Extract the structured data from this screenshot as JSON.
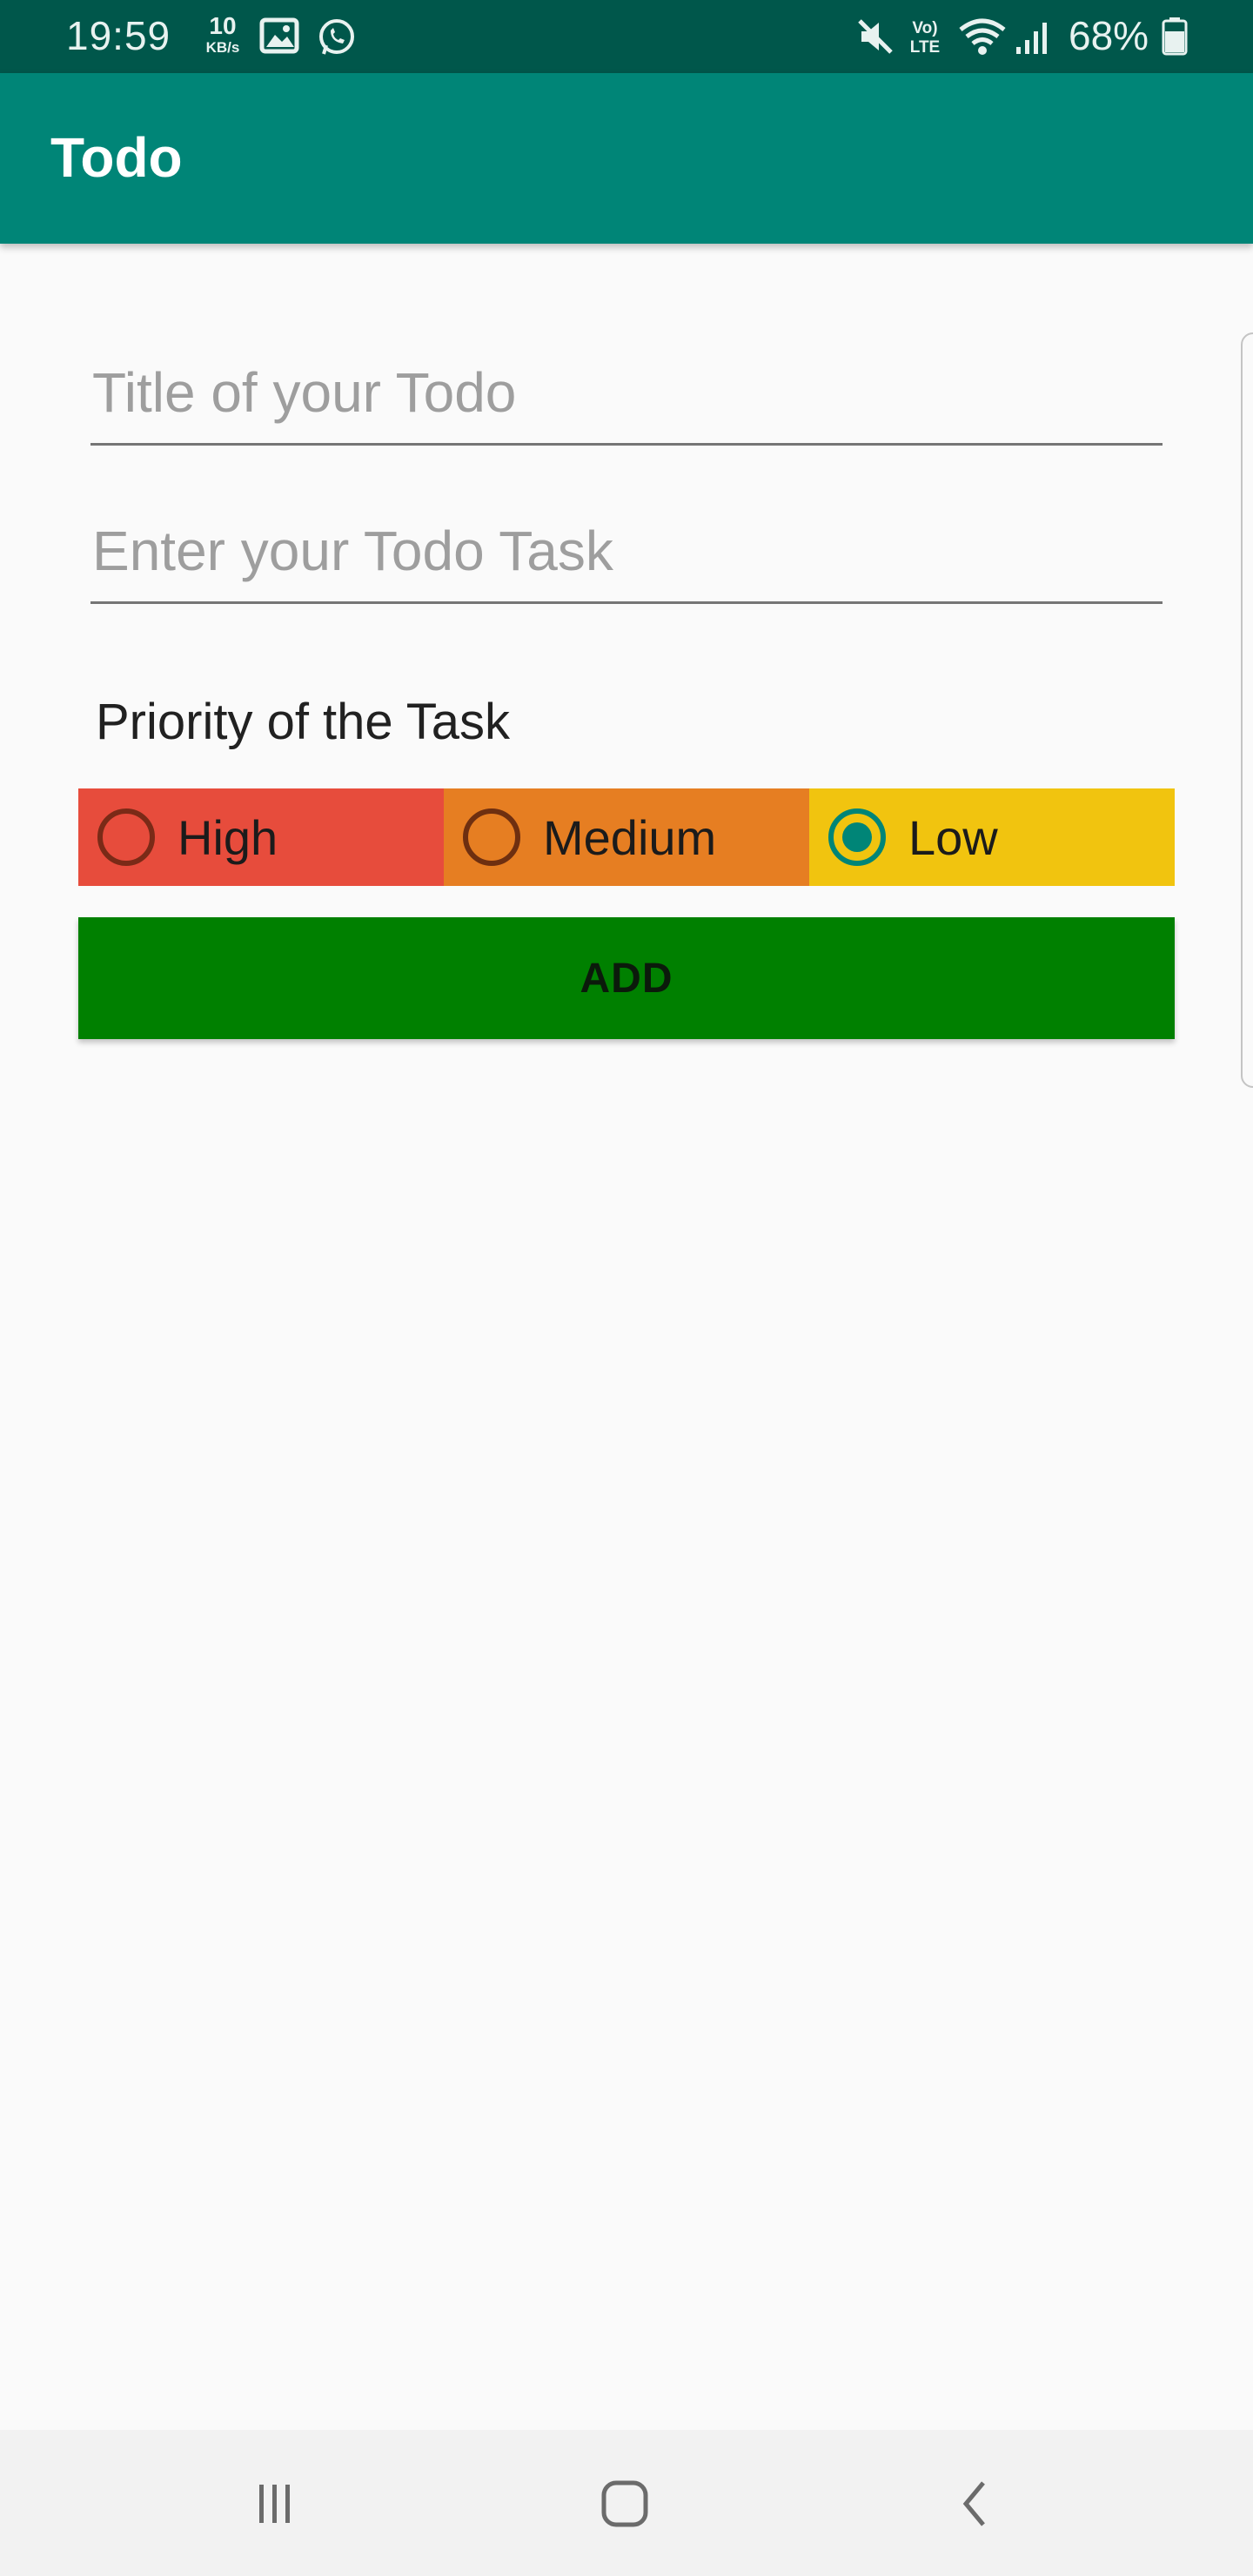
{
  "status_bar": {
    "time": "19:59",
    "net_speed_value": "10",
    "net_speed_unit": "KB/s",
    "battery": "68%",
    "icons": [
      "image-icon",
      "whatsapp-icon",
      "mute-icon",
      "volte-icon",
      "wifi-icon",
      "signal-icon",
      "battery-icon"
    ]
  },
  "app_bar": {
    "title": "Todo"
  },
  "form": {
    "title_placeholder": "Title of your Todo",
    "title_value": "",
    "task_placeholder": "Enter your Todo Task",
    "task_value": "",
    "priority_label": "Priority of the Task",
    "priorities": [
      {
        "label": "High",
        "color": "#e74c3c",
        "selected": false
      },
      {
        "label": "Medium",
        "color": "#e67e22",
        "selected": false
      },
      {
        "label": "Low",
        "color": "#f1c40f",
        "selected": true
      }
    ],
    "add_label": "ADD",
    "add_color": "#008000"
  },
  "colors": {
    "status_bar": "#00574b",
    "app_bar": "#008577",
    "accent": "#008577",
    "background": "#fafafa"
  },
  "nav_bar": {
    "icons": [
      "recent-apps-icon",
      "home-icon",
      "back-icon"
    ]
  }
}
